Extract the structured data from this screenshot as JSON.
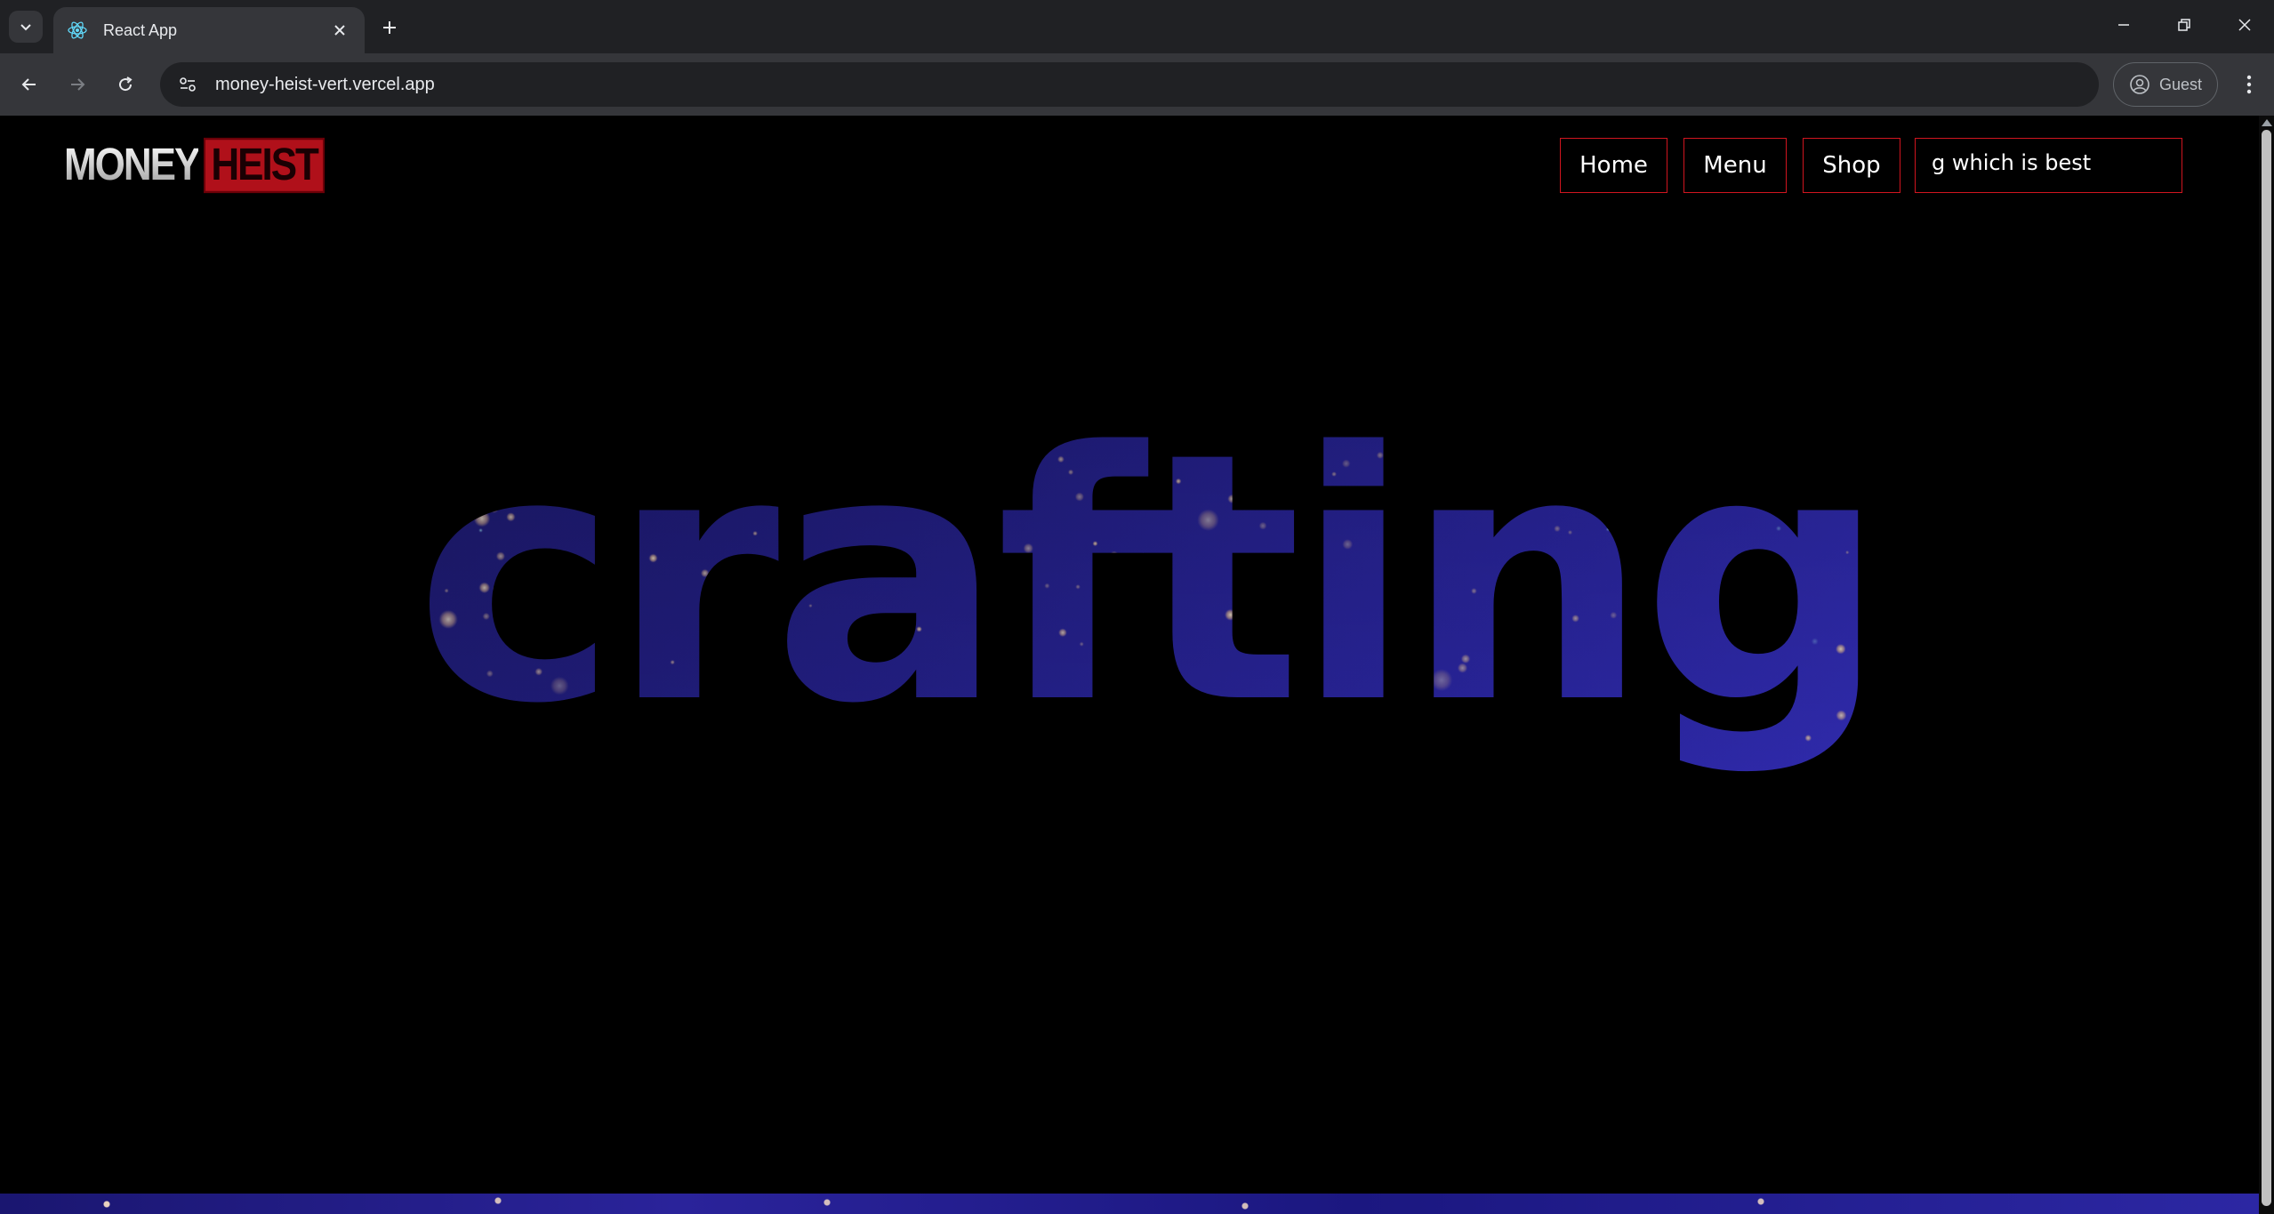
{
  "browser": {
    "tab": {
      "title": "React App"
    },
    "url": "money-heist-vert.vercel.app",
    "profile_label": "Guest"
  },
  "page": {
    "logo": {
      "part1": "MONEY",
      "part2": "HEIST"
    },
    "nav": {
      "home_label": "Home",
      "menu_label": "Menu",
      "shop_label": "Shop",
      "search_value": "g which is best"
    },
    "hero_word": "crafting",
    "accent_color": "#d0151f",
    "fill_colors": [
      "#1c1a7a",
      "#3a34c8",
      "#ffd9a8"
    ]
  }
}
